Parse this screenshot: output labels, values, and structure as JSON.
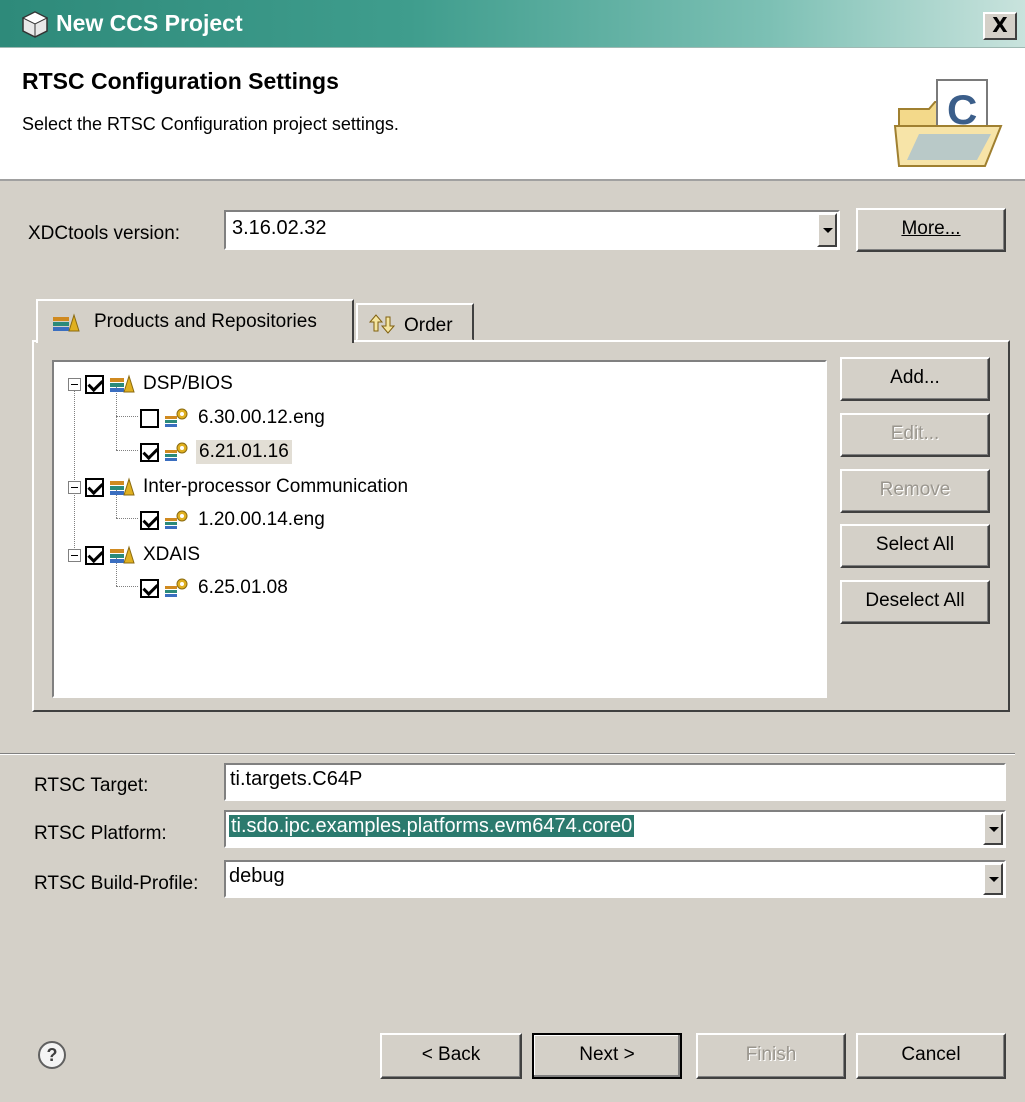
{
  "window": {
    "title": "New CCS Project",
    "close_label": "X"
  },
  "header": {
    "title": "RTSC Configuration Settings",
    "description": "Select the RTSC Configuration project settings."
  },
  "xdctools": {
    "label": "XDCtools version:",
    "value": "3.16.02.32",
    "more_label": "More..."
  },
  "tabs": [
    {
      "label": "Products and Repositories",
      "active": true
    },
    {
      "label": "Order",
      "active": false
    }
  ],
  "tree": [
    {
      "label": "DSP/BIOS",
      "checked": true,
      "children": [
        {
          "label": "6.30.00.12.eng",
          "checked": false
        },
        {
          "label": "6.21.01.16",
          "checked": true,
          "selected": true
        }
      ]
    },
    {
      "label": "Inter-processor Communication",
      "checked": true,
      "children": [
        {
          "label": "1.20.00.14.eng",
          "checked": true
        }
      ]
    },
    {
      "label": "XDAIS",
      "checked": true,
      "children": [
        {
          "label": "6.25.01.08",
          "checked": true
        }
      ]
    }
  ],
  "side_buttons": {
    "add": "Add...",
    "edit": "Edit...",
    "remove": "Remove",
    "select_all": "Select All",
    "deselect_all": "Deselect All"
  },
  "rtsc": {
    "target_label": "RTSC Target:",
    "target_value": "ti.targets.C64P",
    "platform_label": "RTSC Platform:",
    "platform_value": "ti.sdo.ipc.examples.platforms.evm6474.core0",
    "profile_label": "RTSC Build-Profile:",
    "profile_value": "debug"
  },
  "footer": {
    "help_icon": "?",
    "back": "< Back",
    "next": "Next >",
    "finish": "Finish",
    "cancel": "Cancel"
  },
  "colors": {
    "titlebar": "#2e8a7a",
    "dialog_bg": "#d4d0c8",
    "selection": "#2b7a6e"
  }
}
